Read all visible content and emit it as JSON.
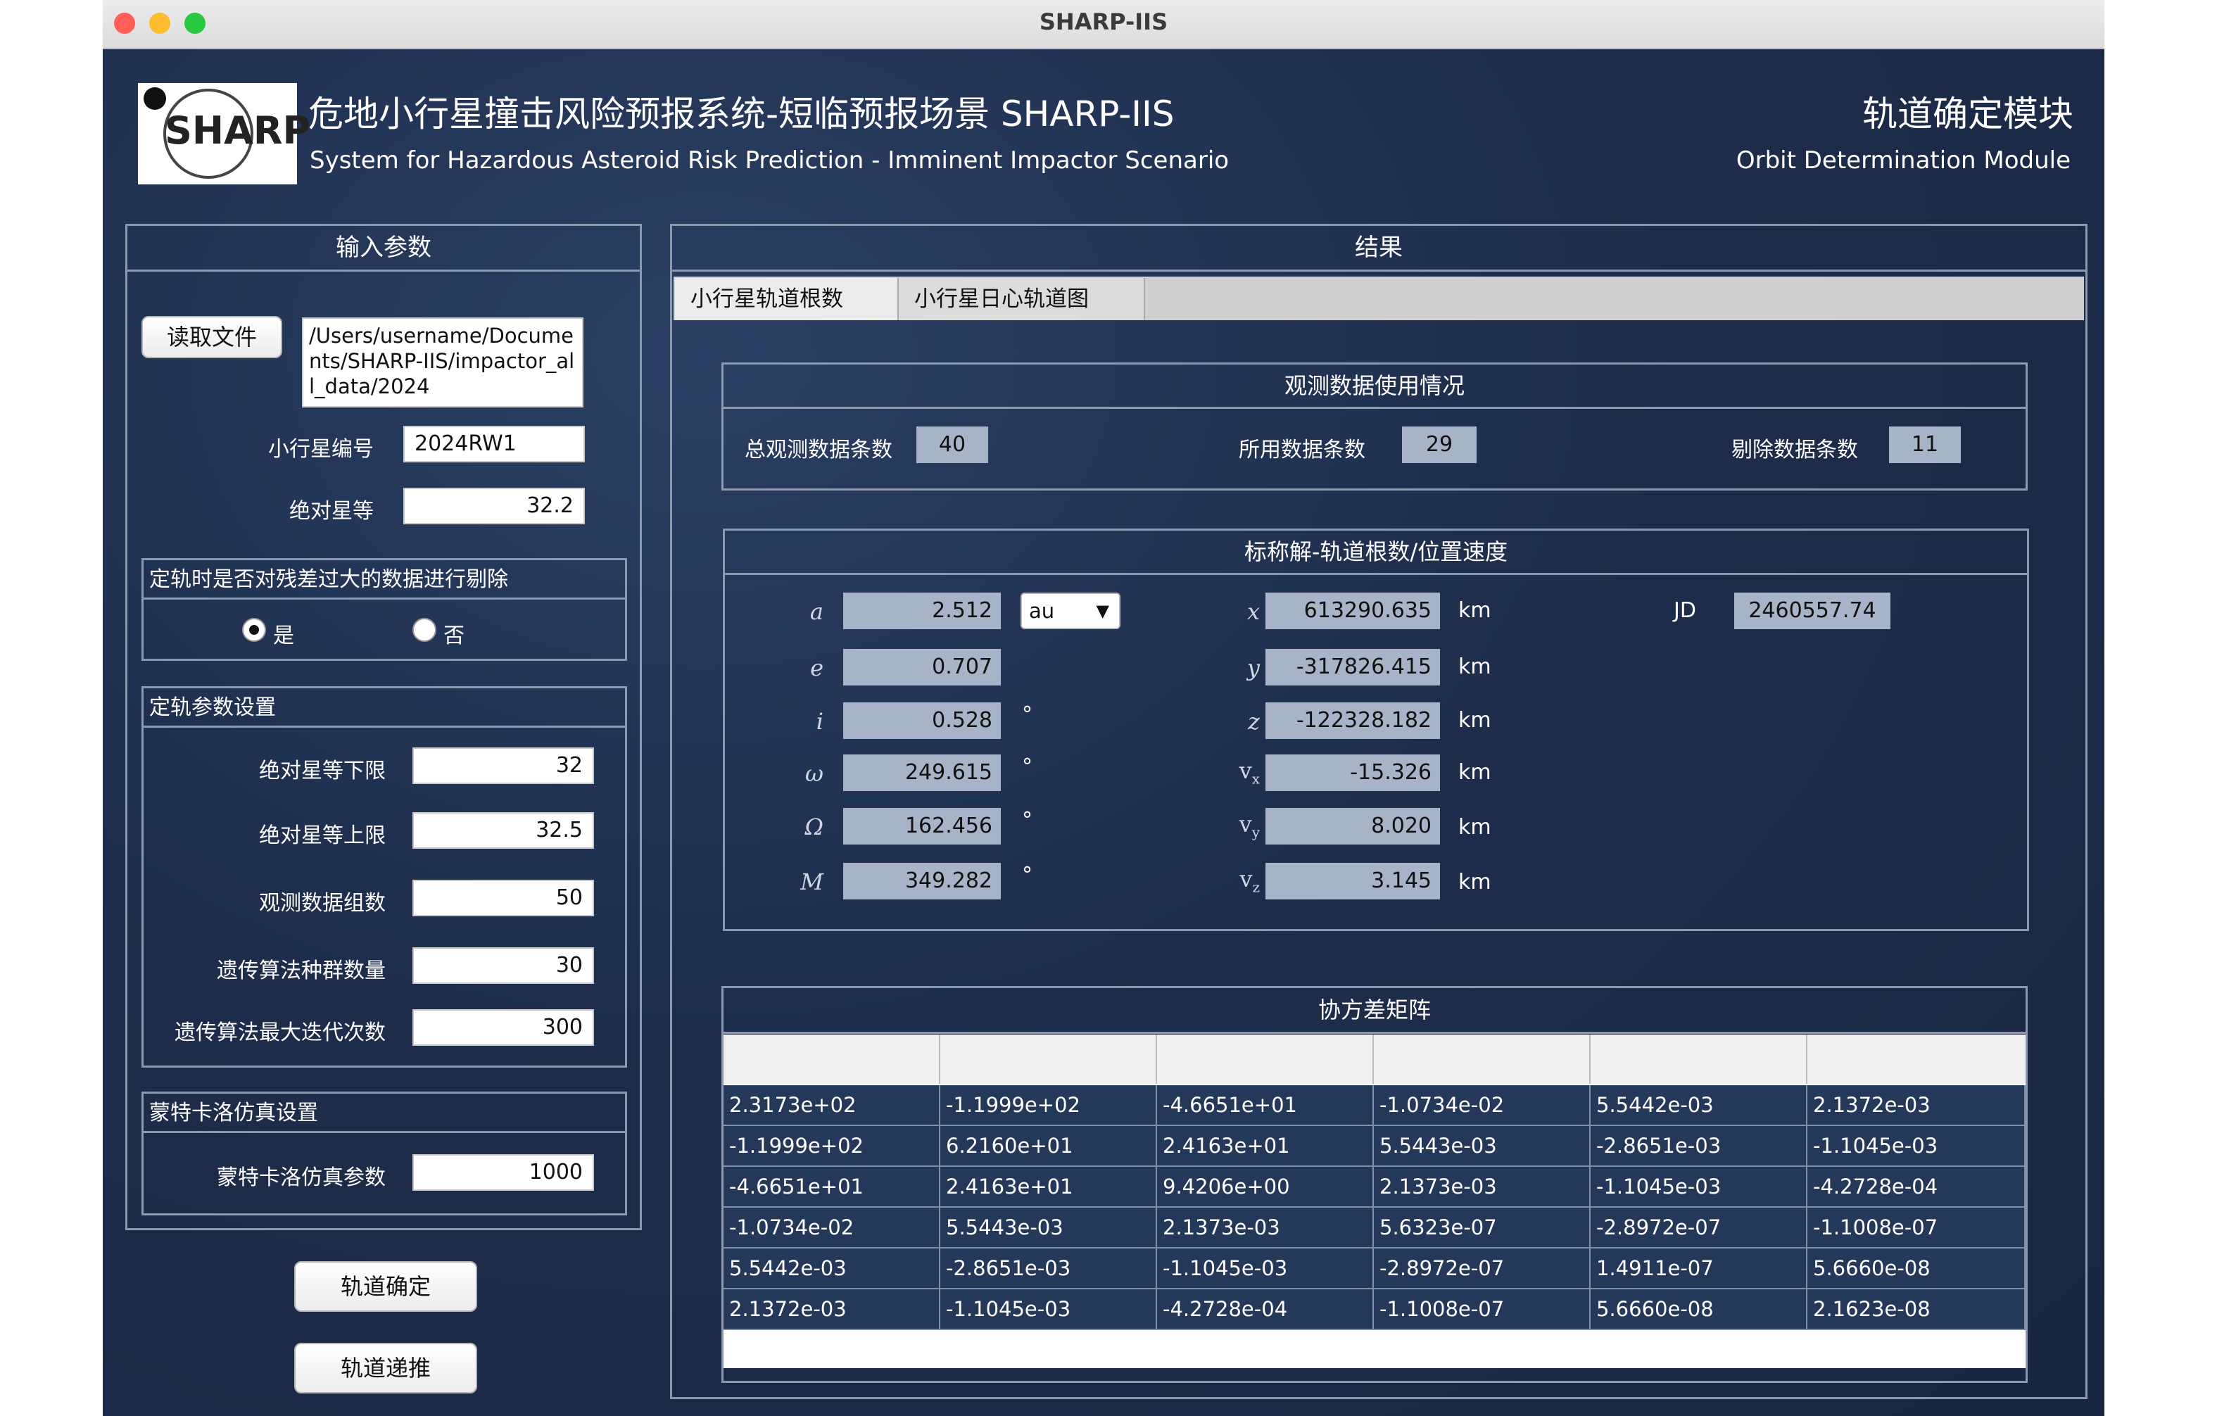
{
  "window": {
    "title": "SHARP-IIS",
    "traffic_lights": {
      "close": "#ff5f57",
      "minimize": "#febc2e",
      "zoom": "#28c840"
    }
  },
  "header": {
    "logo_text": "SHARP",
    "title_cn": "危地小行星撞击风险预报系统-短临预报场景 SHARP-IIS",
    "title_en": "System for Hazardous Asteroid Risk Prediction - Imminent Impactor Scenario",
    "module_cn": "轨道确定模块",
    "module_en": "Orbit Determination Module"
  },
  "input_panel": {
    "title": "输入参数",
    "read_file_button": "读取文件",
    "file_path": "/Users/username/Documents/SHARP-IIS/impactor_all_data/2024",
    "asteroid_id_label": "小行星编号",
    "asteroid_id": "2024RW1",
    "abs_mag_label": "绝对星等",
    "abs_mag": "32.2",
    "reject": {
      "title": "定轨时是否对残差过大的数据进行剔除",
      "yes_label": "是",
      "no_label": "否",
      "selected": "yes"
    },
    "od_settings": {
      "title": "定轨参数设置",
      "fields": [
        {
          "label": "绝对星等下限",
          "value": "32"
        },
        {
          "label": "绝对星等上限",
          "value": "32.5"
        },
        {
          "label": "观测数据组数",
          "value": "50"
        },
        {
          "label": "遗传算法种群数量",
          "value": "30"
        },
        {
          "label": "遗传算法最大迭代次数",
          "value": "300"
        }
      ]
    },
    "mc": {
      "title": "蒙特卡洛仿真设置",
      "label": "蒙特卡洛仿真参数",
      "value": "1000"
    },
    "determine_button": "轨道确定",
    "propagate_button": "轨道递推"
  },
  "results": {
    "title": "结果",
    "tabs": [
      {
        "label": "小行星轨道根数",
        "active": true
      },
      {
        "label": "小行星日心轨道图",
        "active": false
      }
    ],
    "obs_usage": {
      "title": "观测数据使用情况",
      "total_label": "总观测数据条数",
      "total": "40",
      "used_label": "所用数据条数",
      "used": "29",
      "rejected_label": "剔除数据条数",
      "rejected": "11"
    },
    "nominal": {
      "title": "标称解-轨道根数/位置速度",
      "elements": [
        {
          "symbol": "a",
          "value": "2.512"
        },
        {
          "symbol": "e",
          "value": "0.707"
        },
        {
          "symbol": "i",
          "value": "0.528",
          "unit": "°"
        },
        {
          "symbol": "ω",
          "value": "249.615",
          "unit": "°"
        },
        {
          "symbol": "Ω",
          "value": "162.456",
          "unit": "°"
        },
        {
          "symbol": "M",
          "value": "349.282",
          "unit": "°"
        }
      ],
      "a_unit_select": "au",
      "state": [
        {
          "symbol": "x",
          "sub": "",
          "value": "613290.635",
          "unit": "km"
        },
        {
          "symbol": "y",
          "sub": "",
          "value": "-317826.415",
          "unit": "km"
        },
        {
          "symbol": "z",
          "sub": "",
          "value": "-122328.182",
          "unit": "km"
        },
        {
          "symbol": "v",
          "sub": "x",
          "value": "-15.326",
          "unit": "km"
        },
        {
          "symbol": "v",
          "sub": "y",
          "value": "8.020",
          "unit": "km"
        },
        {
          "symbol": "v",
          "sub": "z",
          "value": "3.145",
          "unit": "km"
        }
      ],
      "jd_label": "JD",
      "jd": "2460557.74"
    },
    "covariance": {
      "title": "协方差矩阵",
      "rows": [
        [
          "2.3173e+02",
          "-1.1999e+02",
          "-4.6651e+01",
          "-1.0734e-02",
          "5.5442e-03",
          "2.1372e-03"
        ],
        [
          "-1.1999e+02",
          "6.2160e+01",
          "2.4163e+01",
          "5.5443e-03",
          "-2.8651e-03",
          "-1.1045e-03"
        ],
        [
          "-4.6651e+01",
          "2.4163e+01",
          "9.4206e+00",
          "2.1373e-03",
          "-1.1045e-03",
          "-4.2728e-04"
        ],
        [
          "-1.0734e-02",
          "5.5443e-03",
          "2.1373e-03",
          "5.6323e-07",
          "-2.8972e-07",
          "-1.1008e-07"
        ],
        [
          "5.5442e-03",
          "-2.8651e-03",
          "-1.1045e-03",
          "-2.8972e-07",
          "1.4911e-07",
          "5.6660e-08"
        ],
        [
          "2.1372e-03",
          "-1.1045e-03",
          "-4.2728e-04",
          "-1.1008e-07",
          "5.6660e-08",
          "2.1623e-08"
        ]
      ]
    }
  }
}
